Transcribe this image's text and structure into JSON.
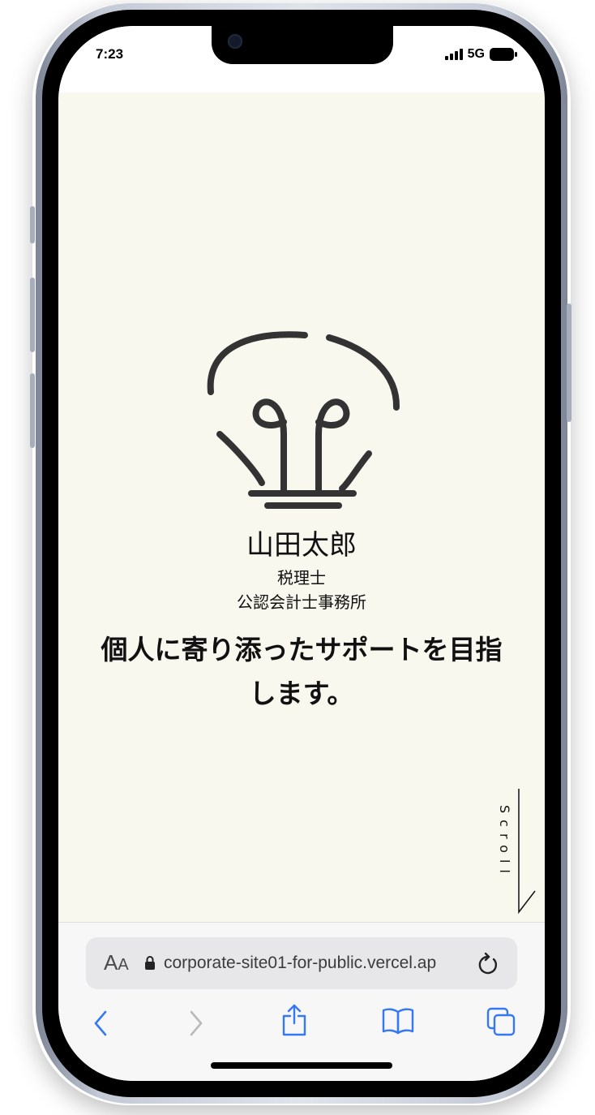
{
  "status_bar": {
    "time": "7:23",
    "network": "5G"
  },
  "hero": {
    "name": "山田太郎",
    "title_line1": "税理士",
    "title_line2": "公認会計士事務所",
    "tagline": "個人に寄り添ったサポートを目指します。",
    "scroll_label": "Scroll"
  },
  "browser": {
    "text_size_big": "A",
    "text_size_small": "A",
    "url": "corporate-site01-for-public.vercel.ap"
  },
  "colors": {
    "page_background": "#f9f8ef",
    "icon_stroke": "#333333",
    "browser_accent": "#3478f6",
    "disabled": "#b9b9b9"
  },
  "icons": [
    "lightbulb-logo-icon",
    "signal-icon",
    "battery-icon",
    "lock-icon",
    "reload-icon",
    "back-icon",
    "forward-icon",
    "share-icon",
    "bookmarks-icon",
    "tabs-icon"
  ]
}
